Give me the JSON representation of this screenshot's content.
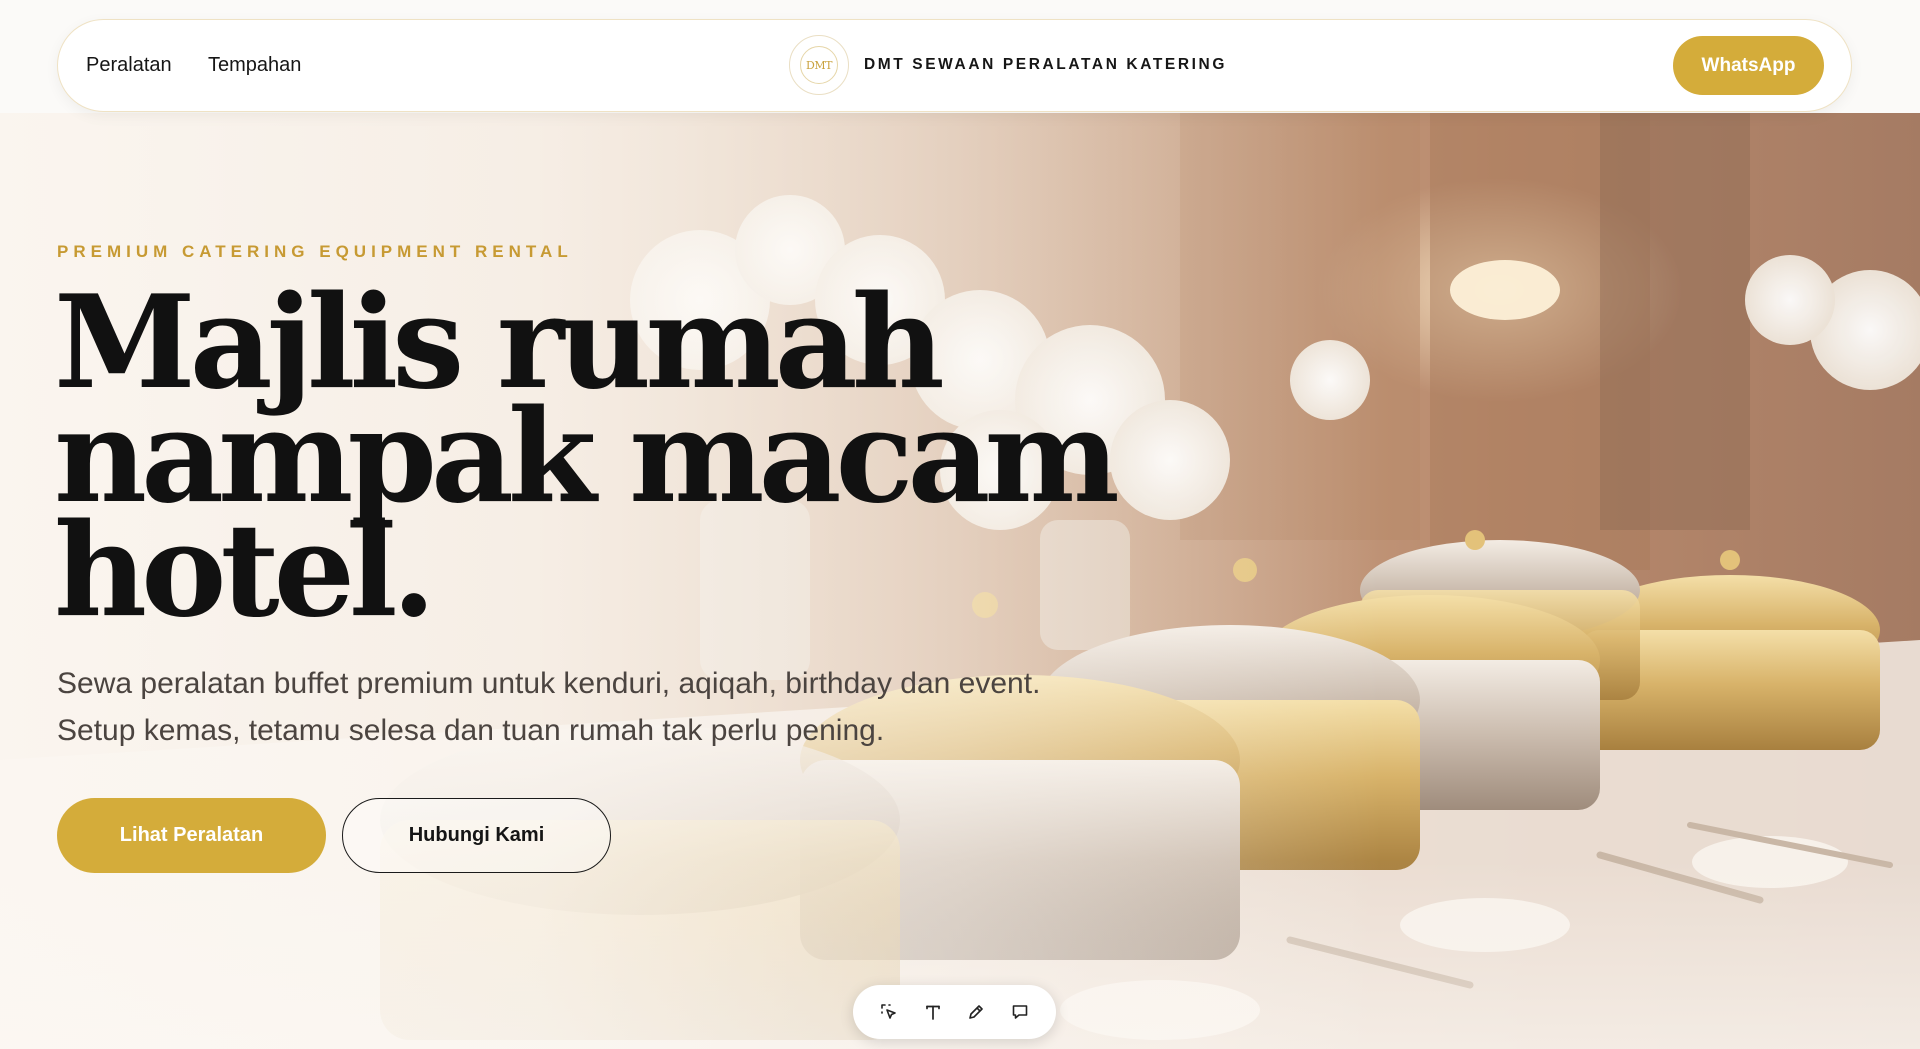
{
  "header": {
    "nav": [
      {
        "label": "Peralatan"
      },
      {
        "label": "Tempahan"
      }
    ],
    "logo_text": "DMT",
    "brand_name": "DMT SEWAAN PERALATAN KATERING",
    "whatsapp_label": "WhatsApp"
  },
  "hero": {
    "eyebrow": "PREMIUM CATERING EQUIPMENT RENTAL",
    "headline_lines": [
      "Majlis rumah",
      "nampak macam",
      "hotel."
    ],
    "subtext_lines": [
      "Sewa peralatan buffet premium untuk kenduri, aqiqah, birthday dan event.",
      "Setup kemas, tetamu selesa dan tuan rumah tak perlu pening."
    ],
    "primary_button": "Lihat Peralatan",
    "secondary_button": "Hubungi Kami"
  },
  "toolbar": {
    "tools": [
      {
        "icon": "select-cursor-icon"
      },
      {
        "icon": "text-icon"
      },
      {
        "icon": "pencil-icon"
      },
      {
        "icon": "comment-icon"
      }
    ]
  },
  "colors": {
    "accent_gold": "#d4ac3a",
    "eyebrow_gold": "#c79a33",
    "headline": "#111111",
    "body_text": "#4b4440"
  }
}
